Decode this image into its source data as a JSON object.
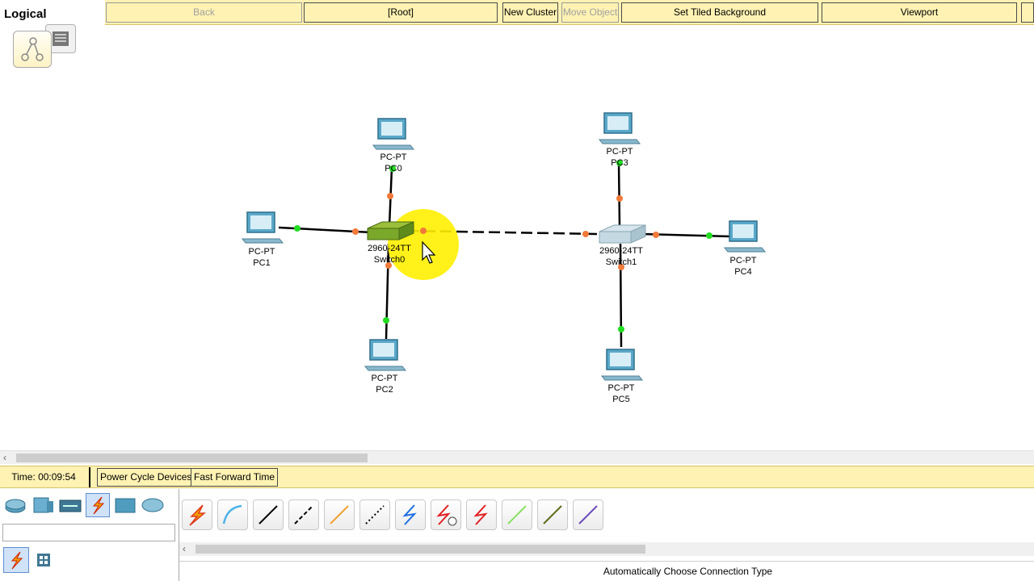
{
  "toolbar": {
    "tab": "Logical",
    "back": "Back",
    "root": "[Root]",
    "new_cluster": "New Cluster",
    "move_object": "Move Object",
    "tiled_bg": "Set Tiled Background",
    "viewport": "Viewport"
  },
  "devices": [
    {
      "model": "PC-PT",
      "name": "PC0"
    },
    {
      "model": "PC-PT",
      "name": "PC1"
    },
    {
      "model": "PC-PT",
      "name": "PC2"
    },
    {
      "model": "PC-PT",
      "name": "PC3"
    },
    {
      "model": "PC-PT",
      "name": "PC4"
    },
    {
      "model": "PC-PT",
      "name": "PC5"
    },
    {
      "model": "2960-24TT",
      "name": "Switch0"
    },
    {
      "model": "2960-24TT",
      "name": "Switch1"
    }
  ],
  "status": {
    "time": "Time: 00:09:54",
    "power_cycle": "Power Cycle Devices",
    "fast_forward": "Fast Forward Time"
  },
  "device_categories": [
    "routers-icon",
    "switches-icon",
    "hubs-icon",
    "connections-icon",
    "end-devices-icon",
    "wan-emulation-icon"
  ],
  "connection_types": [
    {
      "icon": "automatic-connection-icon",
      "color": "#e03c1c"
    },
    {
      "icon": "console-cable-icon",
      "color": "#4fb3e8"
    },
    {
      "icon": "copper-straight-through-icon",
      "color": "#000000"
    },
    {
      "icon": "copper-cross-over-icon",
      "color": "#000000"
    },
    {
      "icon": "fiber-icon",
      "color": "#f0a030"
    },
    {
      "icon": "phone-icon",
      "color": "#000000"
    },
    {
      "icon": "coaxial-icon",
      "color": "#1e6fe0"
    },
    {
      "icon": "serial-dce-icon",
      "color": "#e02020"
    },
    {
      "icon": "serial-dte-icon",
      "color": "#e02020"
    },
    {
      "icon": "octal-icon",
      "color": "#88e060"
    },
    {
      "icon": "iot-custom-icon",
      "color": "#5a6b1c"
    },
    {
      "icon": "usb-icon",
      "color": "#6b4ab8"
    }
  ],
  "connection_status": "Automatically Choose Connection Type"
}
